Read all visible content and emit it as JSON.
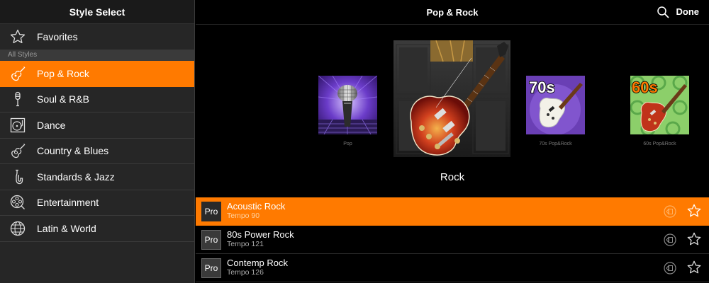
{
  "left_panel": {
    "title": "Style Select",
    "favorites_label": "Favorites",
    "section_label": "All Styles",
    "items": [
      {
        "label": "Pop & Rock",
        "icon": "guitar-icon",
        "active": true
      },
      {
        "label": "Soul & R&B",
        "icon": "microphone-icon",
        "active": false
      },
      {
        "label": "Dance",
        "icon": "turntable-icon",
        "active": false
      },
      {
        "label": "Country & Blues",
        "icon": "acoustic-guitar-icon",
        "active": false
      },
      {
        "label": "Standards & Jazz",
        "icon": "saxophone-icon",
        "active": false
      },
      {
        "label": "Entertainment",
        "icon": "film-reel-icon",
        "active": false
      },
      {
        "label": "Latin & World",
        "icon": "globe-icon",
        "active": false
      }
    ]
  },
  "right_panel": {
    "title": "Pop & Rock",
    "done_label": "Done",
    "carousel": {
      "selected_caption": "Rock",
      "covers": [
        {
          "caption": "Pop",
          "image": "microphone-cover"
        },
        {
          "caption": "",
          "image": "rock-guitar-cover"
        },
        {
          "caption": "70s Pop&Rock",
          "image": "70s-guitar-cover",
          "badge": "70s"
        },
        {
          "caption": "60s Pop&Rock",
          "image": "60s-guitar-cover",
          "badge": "60s"
        }
      ]
    },
    "list": [
      {
        "badge": "Pro",
        "name": "Acoustic Rock",
        "tempo": "Tempo 90",
        "active": true
      },
      {
        "badge": "Pro",
        "name": "80s Power Rock",
        "tempo": "Tempo 121",
        "active": false
      },
      {
        "badge": "Pro",
        "name": "Contemp Rock",
        "tempo": "Tempo 126",
        "active": false
      }
    ]
  },
  "colors": {
    "accent": "#ff7a00",
    "sidebar_bg": "#262626",
    "background": "#000000"
  }
}
